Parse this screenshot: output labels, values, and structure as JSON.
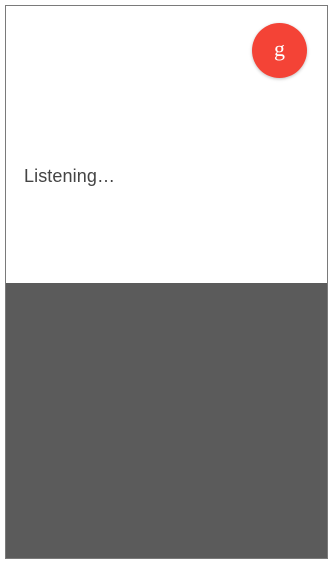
{
  "voice_search": {
    "status_text": "Listening…",
    "mic_button": {
      "icon": "google-g-icon",
      "glyph": "g",
      "color": "#f44336"
    }
  },
  "overlay": {
    "color": "#5b5b5b"
  }
}
